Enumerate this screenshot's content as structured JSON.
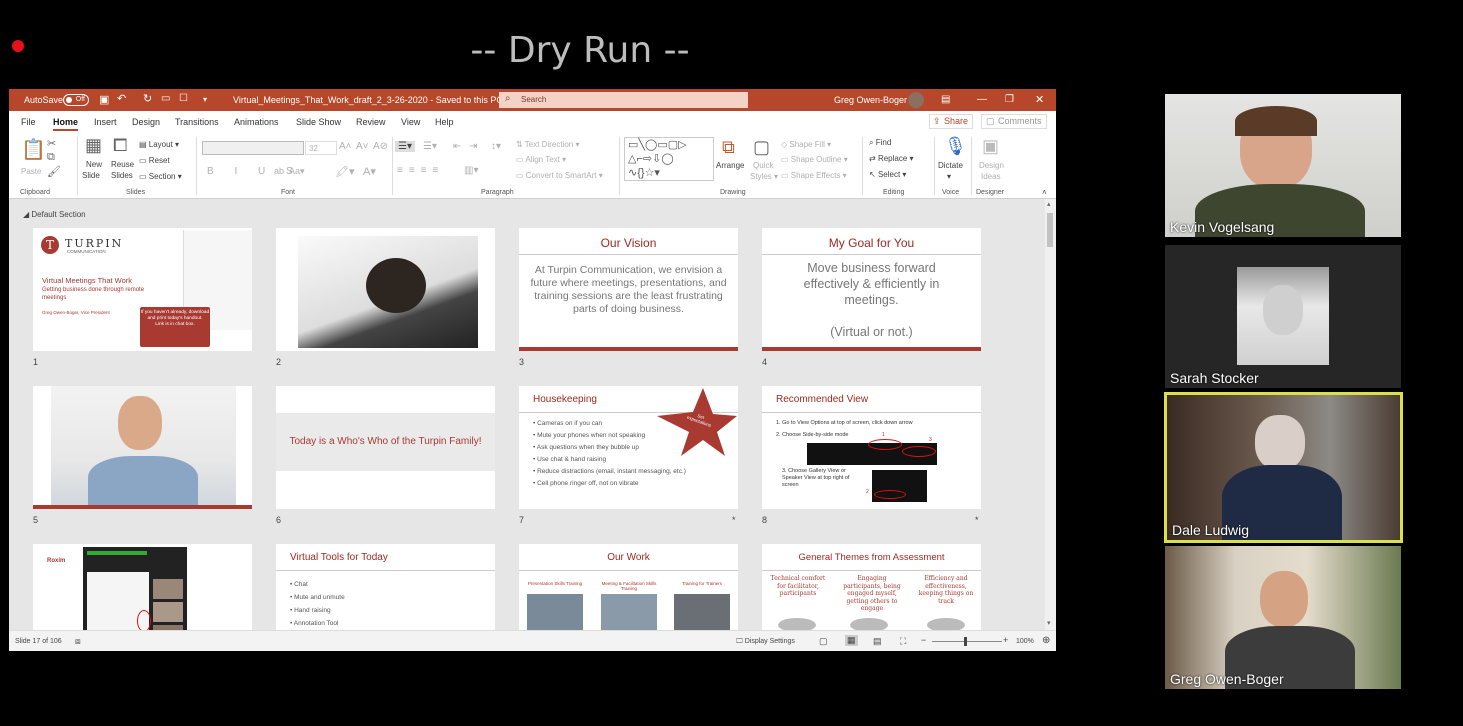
{
  "meeting": {
    "title": "-- Dry Run --"
  },
  "app": {
    "autosave_label": "AutoSave",
    "autosave_state": "Off",
    "filename": "Virtual_Meetings_That_Work_draft_2_3-26-2020 - Saved to this PC",
    "search_placeholder": "Search",
    "user": "Greg Owen-Boger"
  },
  "menu": {
    "tabs": [
      "File",
      "Home",
      "Insert",
      "Design",
      "Transitions",
      "Animations",
      "Slide Show",
      "Review",
      "View",
      "Help"
    ],
    "share": "Share",
    "comments": "Comments"
  },
  "ribbon": {
    "paste": "Paste",
    "new_slide_1": "New",
    "new_slide_2": "Slide",
    "reuse_1": "Reuse",
    "reuse_2": "Slides",
    "layout": "Layout",
    "reset": "Reset",
    "section": "Section",
    "font_size": "32",
    "text_direction": "Text Direction",
    "align_text": "Align Text",
    "convert_smartart": "Convert to SmartArt",
    "arrange": "Arrange",
    "quick_1": "Quick",
    "quick_2": "Styles",
    "shape_fill": "Shape Fill",
    "shape_outline": "Shape Outline",
    "shape_effects": "Shape Effects",
    "find": "Find",
    "replace": "Replace",
    "select": "Select",
    "dictate": "Dictate",
    "design_1": "Design",
    "design_2": "Ideas",
    "groups": {
      "clipboard": "Clipboard",
      "slides": "Slides",
      "font": "Font",
      "paragraph": "Paragraph",
      "drawing": "Drawing",
      "editing": "Editing",
      "voice": "Voice",
      "designer": "Designer"
    }
  },
  "section_label": "Default Section",
  "slides": {
    "s1": {
      "logo": "TURPIN",
      "logo_sub": "COMMUNICATION",
      "title": "Virtual Meetings That Work",
      "subtitle": "Getting business done through remote meetings",
      "presenter": "Greg Owen-Boger, Vice President",
      "callout": "If you haven't already, download and print today's handout.",
      "callout2": "Link is in chat box."
    },
    "s3": {
      "title": "Our Vision",
      "body": "At Turpin Communication, we envision a future where meetings, presentations, and training sessions are the least frustrating parts of doing business."
    },
    "s4": {
      "title": "My Goal for You",
      "body": "Move business forward effectively & efficiently in meetings.",
      "body2": "(Virtual or not.)"
    },
    "s6": {
      "text": "Today is a Who's Who of the Turpin Family!"
    },
    "s7": {
      "title": "Housekeeping",
      "star": "Set expectations",
      "bullets": [
        "Cameras on if you can",
        "Mute your phones when not speaking",
        "Ask questions when they bubble up",
        "Use chat & hand raising",
        "Reduce distractions (email, instant messaging, etc.)",
        "Cell phone ringer off, not on vibrate"
      ]
    },
    "s8": {
      "title": "Recommended View",
      "steps": [
        "1. Go to View Options at top of screen, click down arrow",
        "2. Choose Side-by-side mode",
        "3. Choose Gallery View or Speaker View at top right of screen"
      ],
      "n1": "1",
      "n2": "2",
      "n3": "3"
    },
    "s9": {
      "label": "Roxim"
    },
    "s10": {
      "title": "Virtual Tools for Today",
      "bullets": [
        "Chat",
        "Mute and unmute",
        "Hand raising",
        "Annotation Tool"
      ]
    },
    "s11": {
      "title": "Our Work",
      "cols": [
        "Presentation Skills Training",
        "Meeting & Facilitation Skills Training",
        "Training for Trainers"
      ]
    },
    "s12": {
      "title": "General Themes from Assessment",
      "cols": [
        "Technical comfort for facilitator, participants",
        "Engaging participants, being engaged myself, getting others to engage",
        "Efficiency and effectiveness, keeping things on track"
      ]
    },
    "numbers": [
      "1",
      "2",
      "3",
      "4",
      "5",
      "6",
      "7",
      "8"
    ],
    "star_mark": "*"
  },
  "status": {
    "slide_count": "Slide 17 of 106",
    "display_settings": "Display Settings",
    "zoom": "100%"
  },
  "participants": [
    "Kevin Vogelsang",
    "Sarah Stocker",
    "Dale Ludwig",
    "Greg Owen-Boger"
  ],
  "colors": {
    "brand": "#b7472a",
    "slide_red": "#9c2a22",
    "active_speaker": "#d9e04a"
  }
}
